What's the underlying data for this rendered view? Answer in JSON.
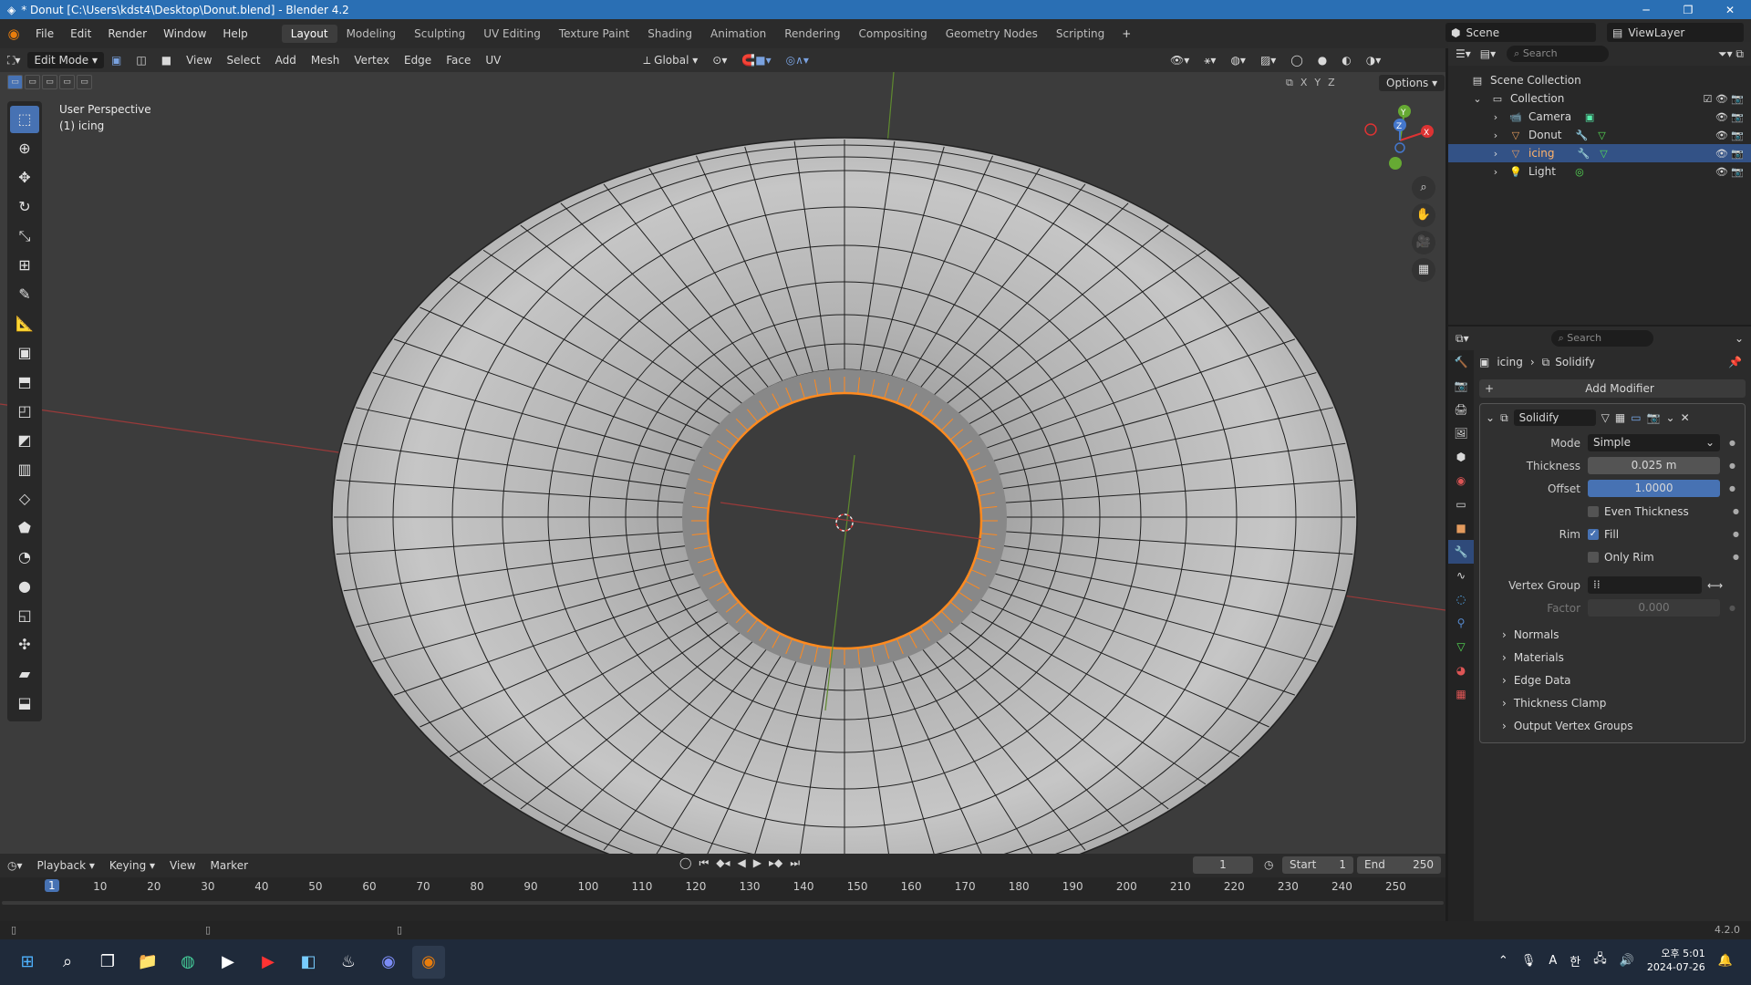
{
  "window": {
    "title": "* Donut [C:\\Users\\kdst4\\Desktop\\Donut.blend] - Blender 4.2"
  },
  "menu": [
    "File",
    "Edit",
    "Render",
    "Window",
    "Help"
  ],
  "workspaces": [
    "Layout",
    "Modeling",
    "Sculpting",
    "UV Editing",
    "Texture Paint",
    "Shading",
    "Animation",
    "Rendering",
    "Compositing",
    "Geometry Nodes",
    "Scripting"
  ],
  "scene": "Scene",
  "view_layer": "ViewLayer",
  "viewport": {
    "mode": "Edit Mode",
    "menus": [
      "View",
      "Select",
      "Add",
      "Mesh",
      "Vertex",
      "Edge",
      "Face",
      "UV"
    ],
    "orientation": "Global",
    "info_line1": "User Perspective",
    "info_line2": "(1) icing",
    "options": "Options",
    "axes": [
      "X",
      "Y",
      "Z"
    ]
  },
  "outliner": {
    "search": "Search",
    "root": "Scene Collection",
    "collection": "Collection",
    "items": [
      {
        "name": "Camera",
        "color": "#e39b5e"
      },
      {
        "name": "Donut",
        "color": "#e39b5e"
      },
      {
        "name": "icing",
        "color": "#e39b5e"
      },
      {
        "name": "Light",
        "color": "#e39b5e"
      }
    ]
  },
  "properties": {
    "search": "Search",
    "breadcrumb_object": "icing",
    "breadcrumb_modifier": "Solidify",
    "add_modifier": "Add Modifier",
    "modifier_name": "Solidify",
    "mode_label": "Mode",
    "mode_value": "Simple",
    "thickness_label": "Thickness",
    "thickness_value": "0.025 m",
    "offset_label": "Offset",
    "offset_value": "1.0000",
    "even_thickness": "Even Thickness",
    "rim_label": "Rim",
    "fill": "Fill",
    "only_rim": "Only Rim",
    "vertex_group_label": "Vertex Group",
    "factor_label": "Factor",
    "factor_value": "0.000",
    "subpanels": [
      "Normals",
      "Materials",
      "Edge Data",
      "Thickness Clamp",
      "Output Vertex Groups"
    ]
  },
  "timeline": {
    "menus": [
      "Playback",
      "Keying",
      "View",
      "Marker"
    ],
    "current_frame": "1",
    "start_label": "Start",
    "start": "1",
    "end_label": "End",
    "end": "250",
    "ruler": [
      "1",
      "10",
      "20",
      "30",
      "40",
      "50",
      "60",
      "70",
      "80",
      "90",
      "100",
      "110",
      "120",
      "130",
      "140",
      "150",
      "160",
      "170",
      "180",
      "190",
      "200",
      "210",
      "220",
      "230",
      "240",
      "250"
    ]
  },
  "status": {
    "version": "4.2.0"
  },
  "taskbar": {
    "time": "오후 5:01",
    "date": "2024-07-26",
    "ime": "A",
    "lang": "한"
  },
  "colors": {
    "accent": "#4772b3",
    "selection_orange": "#ff8a1f",
    "title_bar": "#2a6fb4"
  }
}
